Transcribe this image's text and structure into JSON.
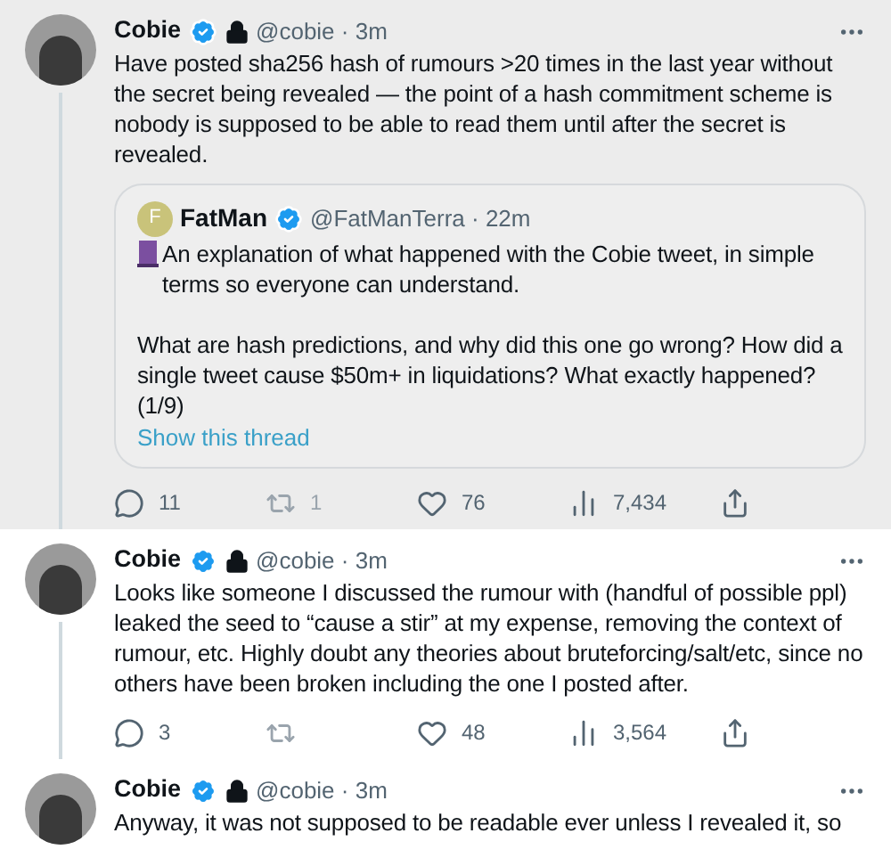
{
  "tweets": [
    {
      "highlighted": true,
      "author": "Cobie",
      "verified": true,
      "locked": true,
      "handle_time": "@cobie · 3m",
      "text": "Have posted sha256 hash of rumours >20 times in the last year without the secret being revealed — the point of a hash commitment scheme is nobody is supposed to be able to read them until after the secret is revealed.",
      "quote": {
        "avatar_letter": "F",
        "author": "FatMan",
        "verified": true,
        "handle_time": "@FatManTerra · 22m",
        "paragraphs": [
          "An explanation of what happened with the Cobie tweet, in simple terms so everyone can understand.",
          "What are hash predictions, and why did this one go wrong? How did a single tweet cause $50m+ in liquidations? What exactly happened? (1/9)"
        ],
        "link": "Show this thread"
      },
      "stats": [
        {
          "kind": "reply",
          "count": "11"
        },
        {
          "kind": "retweet",
          "count": "1"
        },
        {
          "kind": "like",
          "count": "76"
        },
        {
          "kind": "views",
          "count": "7,434"
        },
        {
          "kind": "share"
        }
      ]
    },
    {
      "highlighted": false,
      "author": "Cobie",
      "verified": true,
      "locked": true,
      "handle_time": "@cobie · 3m",
      "text": "Looks like someone I discussed the rumour with (handful of possible ppl) leaked the seed to “cause a stir” at my expense, removing the context of rumour, etc. Highly doubt any theories about bruteforcing/salt/etc, since no others have been broken including the one I posted after.",
      "stats": [
        {
          "kind": "reply",
          "count": "3"
        },
        {
          "kind": "retweet"
        },
        {
          "kind": "like",
          "count": "48"
        },
        {
          "kind": "views",
          "count": "3,564"
        },
        {
          "kind": "share"
        }
      ]
    },
    {
      "highlighted": false,
      "author": "Cobie",
      "verified": true,
      "locked": true,
      "handle_time": "@cobie · 3m",
      "text": "Anyway, it was not supposed to be readable ever unless I revealed it, so"
    }
  ]
}
